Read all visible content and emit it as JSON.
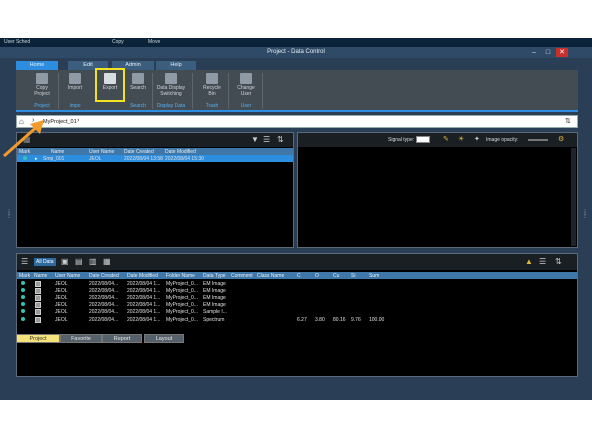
{
  "desktop_strip": [
    "User Sched",
    "Copy",
    "Move"
  ],
  "window": {
    "title": "Project - Data Control",
    "min": "–",
    "max": "□",
    "close": "✕"
  },
  "ribbon_tabs": [
    "Home",
    "Edit",
    "Admin",
    "Help"
  ],
  "ribbon": {
    "buttons": [
      {
        "label": "Copy Project",
        "icon": "copy-project-icon"
      },
      {
        "label": "Import",
        "icon": "import-icon"
      },
      {
        "label": "Export",
        "icon": "export-icon"
      },
      {
        "label": "Search",
        "icon": "search-icon"
      },
      {
        "label": "Data Display Switching",
        "icon": "display-switch-icon"
      },
      {
        "label": "Recycle Bin",
        "icon": "recycle-bin-icon"
      },
      {
        "label": "Change User",
        "icon": "change-user-icon"
      }
    ],
    "groups": [
      "Project",
      "Impo",
      "Search",
      "Display Data",
      "Trash",
      "User"
    ]
  },
  "breadcrumb": {
    "project": "MyProject_01"
  },
  "left_table": {
    "headers": [
      "Mark",
      "Name",
      "User Name",
      "Date Created",
      "Date Modified"
    ],
    "rows": [
      {
        "mark": "",
        "name": "Smp_001",
        "user": "JEOL",
        "created": "2022/08/04 13:58",
        "modified": "2022/08/04 15:30"
      }
    ]
  },
  "right_panel": {
    "signal_type_label": "Signal type:",
    "image_opacity_label": "Image opacity:"
  },
  "bottom_table": {
    "toolbar_label": "All Data",
    "headers": [
      "Mark",
      "Name",
      "User Name",
      "Date Created",
      "Date Modified",
      "Folder Name",
      "Data Type",
      "Comment",
      "Class Name",
      "C",
      "O",
      "Cu",
      "Si",
      "Sum"
    ],
    "rows": [
      {
        "user": "JEOL",
        "created": "2022/08/04...",
        "modified": "2022/08/04 1...",
        "folder": "MyProject_0...",
        "type": "EM Image",
        "c": "",
        "o": "",
        "cu": "",
        "si": "",
        "sum": ""
      },
      {
        "user": "JEOL",
        "created": "2022/08/04...",
        "modified": "2022/08/04 1...",
        "folder": "MyProject_0...",
        "type": "EM Image",
        "c": "",
        "o": "",
        "cu": "",
        "si": "",
        "sum": ""
      },
      {
        "user": "JEOL",
        "created": "2022/08/04...",
        "modified": "2022/08/04 1...",
        "folder": "MyProject_0...",
        "type": "EM Image",
        "c": "",
        "o": "",
        "cu": "",
        "si": "",
        "sum": ""
      },
      {
        "user": "JEOL",
        "created": "2022/08/04...",
        "modified": "2022/08/04 1...",
        "folder": "MyProject_0...",
        "type": "EM Image",
        "c": "",
        "o": "",
        "cu": "",
        "si": "",
        "sum": ""
      },
      {
        "user": "JEOL",
        "created": "2022/08/04...",
        "modified": "2022/08/04 1...",
        "folder": "MyProject_0...",
        "type": "Sample I...",
        "c": "",
        "o": "",
        "cu": "",
        "si": "",
        "sum": ""
      },
      {
        "user": "JEOL",
        "created": "2022/08/04...",
        "modified": "2022/08/04 1...",
        "folder": "MyProject_0...",
        "type": "Spectrum",
        "c": "6.27",
        "o": "3.80",
        "cu": "80.16",
        "si": "9.76",
        "sum": "100.00"
      }
    ]
  },
  "bottom_tabs": [
    "Project",
    "Favorite",
    "Report",
    "Layout"
  ],
  "colors": {
    "accent": "#2d8ee0",
    "highlight": "#f2e21f",
    "arrow": "#f39c2b",
    "active_tab": "#f6e27a"
  }
}
